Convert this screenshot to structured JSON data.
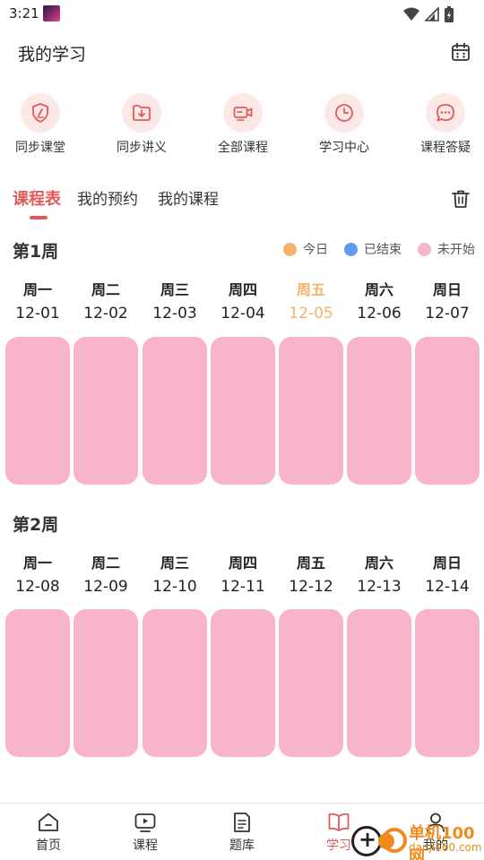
{
  "status_bar": {
    "time": "3:21"
  },
  "header": {
    "title": "我的学习",
    "calendar_icon": "calendar-icon"
  },
  "quick_nav": [
    {
      "label": "同步课堂",
      "icon": "shield-pen-icon"
    },
    {
      "label": "同步讲义",
      "icon": "folder-download-icon"
    },
    {
      "label": "全部课程",
      "icon": "video-camera-icon"
    },
    {
      "label": "学习中心",
      "icon": "clock-icon"
    },
    {
      "label": "课程答疑",
      "icon": "chat-bubble-icon"
    }
  ],
  "tabs": [
    {
      "label": "课程表",
      "active": true
    },
    {
      "label": "我的预约",
      "active": false
    },
    {
      "label": "我的课程",
      "active": false
    }
  ],
  "legend": [
    {
      "label": "今日",
      "color": "#f6b26b"
    },
    {
      "label": "已结束",
      "color": "#5b9cf2"
    },
    {
      "label": "未开始",
      "color": "#f8b4cb"
    }
  ],
  "weeks": [
    {
      "title": "第1周",
      "days": [
        {
          "name": "周一",
          "date": "12-01"
        },
        {
          "name": "周二",
          "date": "12-02"
        },
        {
          "name": "周三",
          "date": "12-03"
        },
        {
          "name": "周四",
          "date": "12-04"
        },
        {
          "name": "周五",
          "date": "12-05",
          "today": true
        },
        {
          "name": "周六",
          "date": "12-06"
        },
        {
          "name": "周日",
          "date": "12-07"
        }
      ]
    },
    {
      "title": "第2周",
      "days": [
        {
          "name": "周一",
          "date": "12-08"
        },
        {
          "name": "周二",
          "date": "12-09"
        },
        {
          "name": "周三",
          "date": "12-10"
        },
        {
          "name": "周四",
          "date": "12-11"
        },
        {
          "name": "周五",
          "date": "12-12"
        },
        {
          "name": "周六",
          "date": "12-13"
        },
        {
          "name": "周日",
          "date": "12-14"
        }
      ]
    }
  ],
  "bottom_nav": [
    {
      "label": "首页",
      "icon": "home-icon"
    },
    {
      "label": "课程",
      "icon": "video-play-icon"
    },
    {
      "label": "题库",
      "icon": "document-icon"
    },
    {
      "label": "学习",
      "icon": "book-open-icon",
      "active": true
    },
    {
      "label": "我的",
      "icon": "user-icon"
    }
  ],
  "colors": {
    "accent": "#e05a5a",
    "today": "#f6b26b",
    "not_started": "#f8b4cb",
    "ended": "#5b9cf2"
  },
  "watermark": {
    "name": "单机100网",
    "url": "danji100.com"
  }
}
